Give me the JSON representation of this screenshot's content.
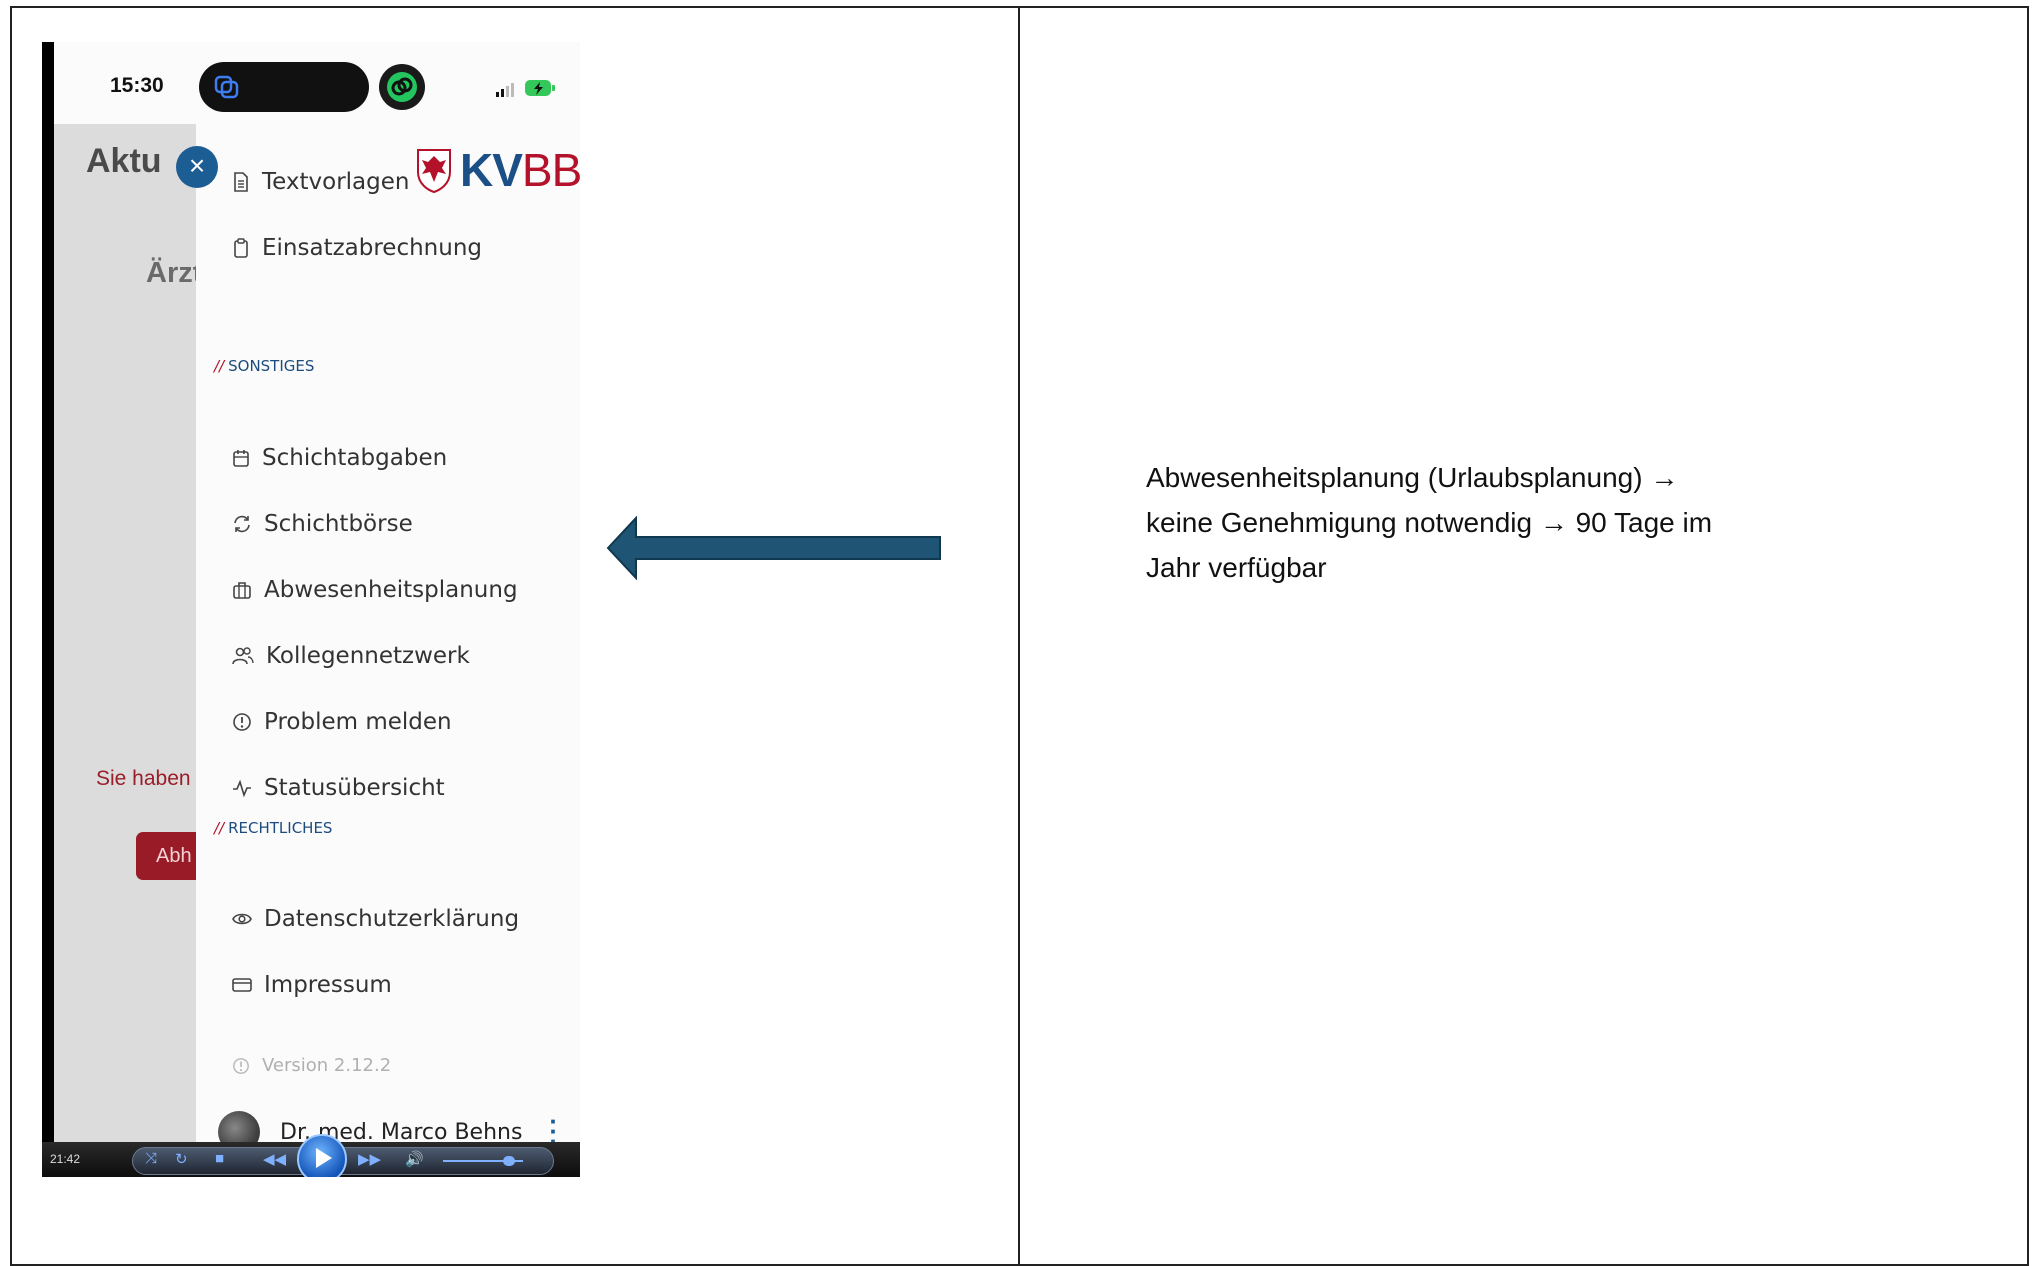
{
  "phone": {
    "status_time": "15:30",
    "background": {
      "title": "Aktu",
      "subtitle": "Ärzt",
      "red_text": "Sie haben",
      "red_button": "Abh"
    },
    "drawer": {
      "logo_kv": "KV",
      "logo_bb": "BB",
      "items_top": [
        {
          "label": "Textvorlagen",
          "icon": "document-icon"
        },
        {
          "label": "Einsatzabrechnung",
          "icon": "clipboard-icon"
        }
      ],
      "section_sonstiges": "SONSTIGES",
      "items_sonstiges": [
        {
          "label": "Schichtabgaben",
          "icon": "calendar-icon"
        },
        {
          "label": "Schichtbörse",
          "icon": "refresh-icon"
        },
        {
          "label": "Abwesenheitsplanung",
          "icon": "briefcase-icon"
        },
        {
          "label": "Kollegennetzwerk",
          "icon": "users-icon"
        },
        {
          "label": "Problem melden",
          "icon": "alert-icon"
        },
        {
          "label": "Statusübersicht",
          "icon": "activity-icon"
        }
      ],
      "section_rechtliches": "RECHTLICHES",
      "items_rechtliches": [
        {
          "label": "Datenschutzerklärung",
          "icon": "eye-icon"
        },
        {
          "label": "Impressum",
          "icon": "card-icon"
        }
      ],
      "version": "Version 2.12.2",
      "user_name": "Dr. med. Marco Behns"
    },
    "player": {
      "time": "21:42"
    }
  },
  "annotation": {
    "line1": "Abwesenheitsplanung (Urlaubsplanung) →",
    "line2": "keine Genehmigung notwendig → 90 Tage im",
    "line3": "Jahr verfügbar"
  },
  "colors": {
    "arrow_fill": "#1f5474",
    "kv_blue": "#1b4f86",
    "kv_red": "#b3122a"
  }
}
